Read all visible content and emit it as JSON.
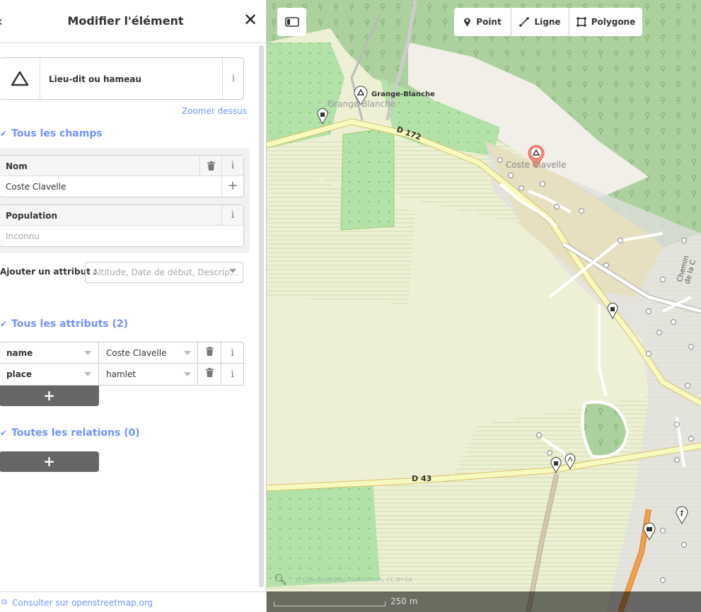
{
  "sidebar": {
    "header": {
      "title": "Modifier l'élément"
    },
    "preset": {
      "name": "Lieu-dit ou hameau",
      "info": "i"
    },
    "zoom_link": "Zoomer dessus",
    "all_fields": {
      "label": "Tous les champs"
    },
    "fields": [
      {
        "label": "Nom",
        "value": "Coste Clavelle"
      },
      {
        "label": "Population",
        "placeholder": "Inconnu"
      }
    ],
    "add_attribute": {
      "label": "Ajouter un attribut :",
      "placeholder": "Altitude, Date de début, Descrip…"
    },
    "all_tags": {
      "label": "Tous les attributs (2)"
    },
    "tags": [
      {
        "key": "name",
        "value": "Coste Clavelle"
      },
      {
        "key": "place",
        "value": "hamlet"
      }
    ],
    "relations": {
      "label": "Toutes les relations (0)"
    },
    "footer_link": "Consulter sur openstreetmap.org"
  },
  "map": {
    "toolbar": {
      "point": "Point",
      "line": "Ligne",
      "polygon": "Polygone"
    },
    "labels": {
      "grange_blanche": "Grange-Blanche",
      "grange_blanche_area": "Grange-Blanche",
      "d172": "D 172",
      "coste_clavelle": "Coste Clavelle",
      "d43": "D 43",
      "chemin": "Chemin de la C"
    },
    "scale": "250 m",
    "attribution": "© OpenStreetMap contributors, CC-BY-SA"
  },
  "colors": {
    "accent": "#7092ff",
    "forest": "#add19e",
    "vineyard": "#b3e2a8",
    "farmland": "#eef0d5",
    "road_secondary": "#f7fabf",
    "residential": "#e0dfdf"
  }
}
